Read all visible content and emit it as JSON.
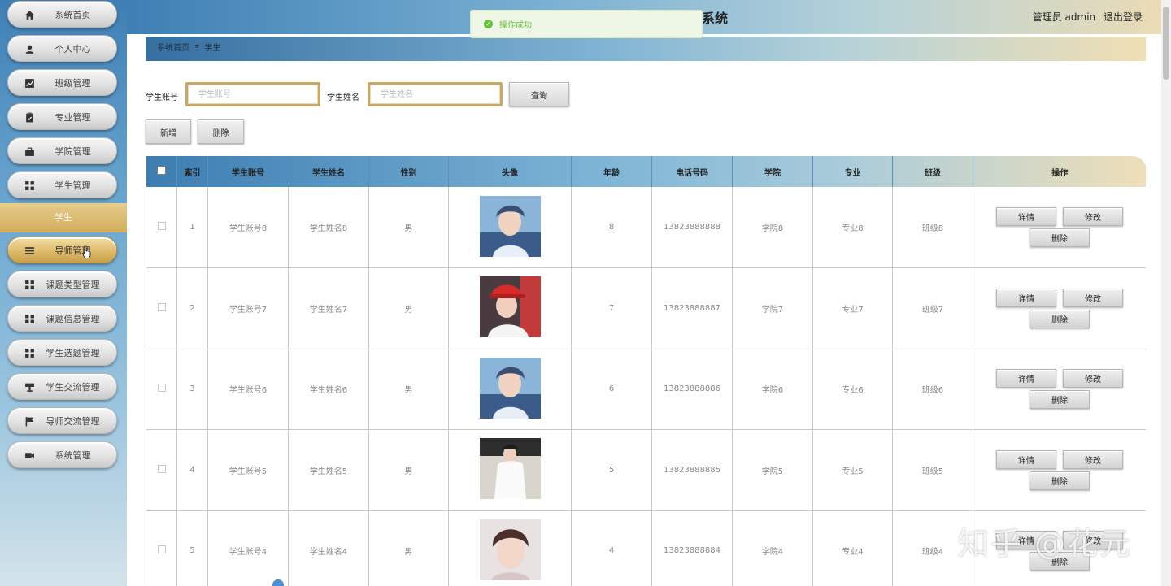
{
  "header": {
    "title": "系统",
    "user": "管理员 admin",
    "logout": "退出登录"
  },
  "toast": {
    "message": "操作成功"
  },
  "sidebar": {
    "items": [
      {
        "label": "系统首页",
        "icon": "home-icon"
      },
      {
        "label": "个人中心",
        "icon": "user-icon"
      },
      {
        "label": "班级管理",
        "icon": "chart-icon"
      },
      {
        "label": "专业管理",
        "icon": "clipboard-icon"
      },
      {
        "label": "学院管理",
        "icon": "briefcase-icon"
      },
      {
        "label": "学生管理",
        "icon": "grid-icon"
      },
      {
        "label": "导师管理",
        "icon": "list-icon"
      },
      {
        "label": "课题类型管理",
        "icon": "grid-icon"
      },
      {
        "label": "课题信息管理",
        "icon": "grid-icon"
      },
      {
        "label": "学生选题管理",
        "icon": "grid-icon"
      },
      {
        "label": "学生交流管理",
        "icon": "cup-icon"
      },
      {
        "label": "导师交流管理",
        "icon": "flag-icon"
      },
      {
        "label": "系统管理",
        "icon": "video-icon"
      }
    ],
    "sub_item": "学生"
  },
  "breadcrumb": {
    "home": "系统首页",
    "sep": "Ξ",
    "current": "学生"
  },
  "search": {
    "account_label": "学生账号",
    "account_placeholder": "学生账号",
    "name_label": "学生姓名",
    "name_placeholder": "学生姓名",
    "query_button": "查询"
  },
  "actions": {
    "add": "新增",
    "delete": "删除"
  },
  "table": {
    "headers": [
      "索引",
      "学生账号",
      "学生姓名",
      "性别",
      "头像",
      "年龄",
      "电话号码",
      "学院",
      "专业",
      "班级",
      "操作"
    ],
    "rows": [
      {
        "index": "1",
        "account": "学生账号8",
        "name": "学生姓名8",
        "gender": "男",
        "age": "8",
        "phone": "13823888888",
        "college": "学院8",
        "major": "专业8",
        "class": "班级8"
      },
      {
        "index": "2",
        "account": "学生账号7",
        "name": "学生姓名7",
        "gender": "男",
        "age": "7",
        "phone": "13823888887",
        "college": "学院7",
        "major": "专业7",
        "class": "班级7"
      },
      {
        "index": "3",
        "account": "学生账号6",
        "name": "学生姓名6",
        "gender": "男",
        "age": "6",
        "phone": "13823888886",
        "college": "学院6",
        "major": "专业6",
        "class": "班级6"
      },
      {
        "index": "4",
        "account": "学生账号5",
        "name": "学生姓名5",
        "gender": "男",
        "age": "5",
        "phone": "13823888885",
        "college": "学院5",
        "major": "专业5",
        "class": "班级5"
      },
      {
        "index": "5",
        "account": "学生账号4",
        "name": "学生姓名4",
        "gender": "男",
        "age": "4",
        "phone": "13823888884",
        "college": "学院4",
        "major": "专业4",
        "class": "班级4"
      }
    ],
    "op_detail": "详情",
    "op_edit": "修改",
    "op_delete": "删除"
  },
  "watermark": "知乎 @花元"
}
